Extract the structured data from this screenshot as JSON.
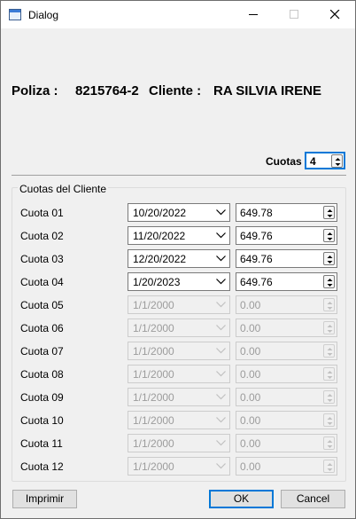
{
  "window": {
    "title": "Dialog"
  },
  "header": {
    "poliza_label": "Poliza :",
    "poliza_value": "8215764-2",
    "cliente_label": "Cliente :",
    "cliente_value": "RA SILVIA IRENE"
  },
  "cuotas": {
    "label": "Cuotas",
    "value": "4"
  },
  "group": {
    "title": "Cuotas del Cliente"
  },
  "rows": [
    {
      "label": "Cuota 01",
      "date": "10/20/2022",
      "amount": "649.78",
      "enabled": true
    },
    {
      "label": "Cuota 02",
      "date": "11/20/2022",
      "amount": "649.76",
      "enabled": true
    },
    {
      "label": "Cuota 03",
      "date": "12/20/2022",
      "amount": "649.76",
      "enabled": true
    },
    {
      "label": "Cuota 04",
      "date": "1/20/2023",
      "amount": "649.76",
      "enabled": true
    },
    {
      "label": "Cuota 05",
      "date": "1/1/2000",
      "amount": "0.00",
      "enabled": false
    },
    {
      "label": "Cuota 06",
      "date": "1/1/2000",
      "amount": "0.00",
      "enabled": false
    },
    {
      "label": "Cuota 07",
      "date": "1/1/2000",
      "amount": "0.00",
      "enabled": false
    },
    {
      "label": "Cuota 08",
      "date": "1/1/2000",
      "amount": "0.00",
      "enabled": false
    },
    {
      "label": "Cuota 09",
      "date": "1/1/2000",
      "amount": "0.00",
      "enabled": false
    },
    {
      "label": "Cuota 10",
      "date": "1/1/2000",
      "amount": "0.00",
      "enabled": false
    },
    {
      "label": "Cuota 11",
      "date": "1/1/2000",
      "amount": "0.00",
      "enabled": false
    },
    {
      "label": "Cuota 12",
      "date": "1/1/2000",
      "amount": "0.00",
      "enabled": false
    }
  ],
  "buttons": {
    "print": "Imprimir",
    "ok": "OK",
    "cancel": "Cancel"
  },
  "colors": {
    "focus": "#0078d7",
    "disabled_text": "#9c9c9c"
  }
}
